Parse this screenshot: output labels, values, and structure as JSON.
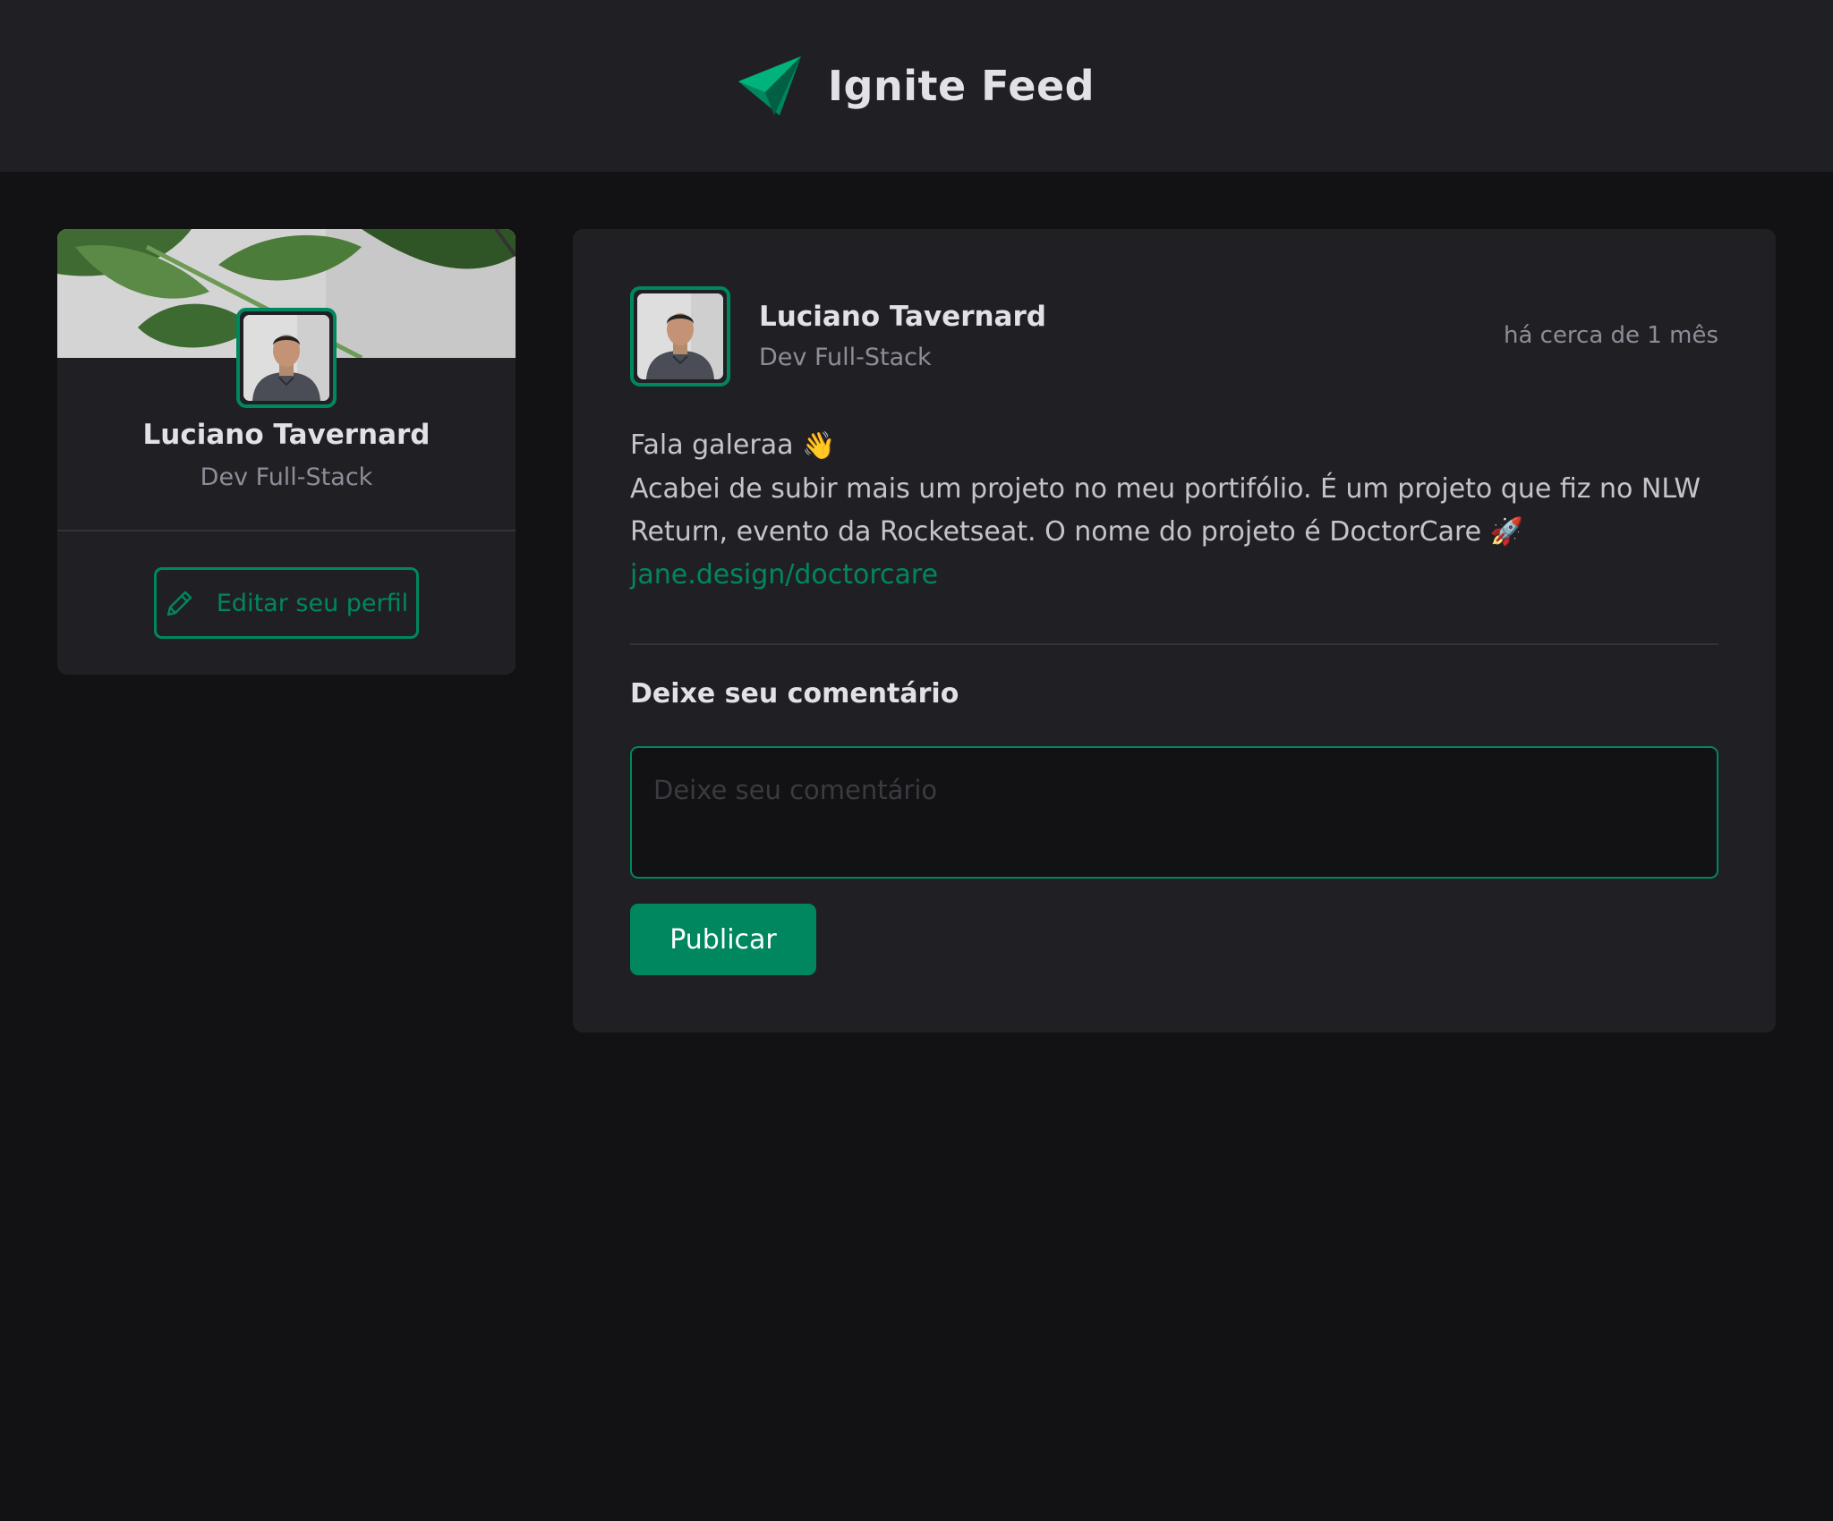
{
  "header": {
    "logo_icon": "ignite-paper-plane-icon",
    "title": "Ignite Feed"
  },
  "sidebar": {
    "cover_image": "leaves-cover",
    "avatar": "user-avatar",
    "name": "Luciano Tavernard",
    "role": "Dev Full-Stack",
    "edit_button": {
      "icon": "pencil-icon",
      "label": "Editar seu perfil"
    }
  },
  "post": {
    "author": {
      "name": "Luciano Tavernard",
      "role": "Dev Full-Stack"
    },
    "time": "há cerca de 1 mês",
    "content": {
      "line1": "Fala galeraa",
      "line1_emoji": "👋",
      "line2": "Acabei de subir mais um projeto no meu portifólio. É um projeto que fiz no NLW Return, evento da Rocketseat. O nome do projeto é DoctorCare",
      "line2_emoji": "🚀",
      "link": "jane.design/doctorcare"
    },
    "comment_section": {
      "title": "Deixe seu comentário",
      "placeholder": "Deixe seu comentário",
      "value": ""
    },
    "publish_button": "Publicar"
  },
  "colors": {
    "background": "#121214",
    "panel": "#202024",
    "accent": "#00875f",
    "text": "#e1e1e6",
    "muted": "#8d8d99"
  }
}
